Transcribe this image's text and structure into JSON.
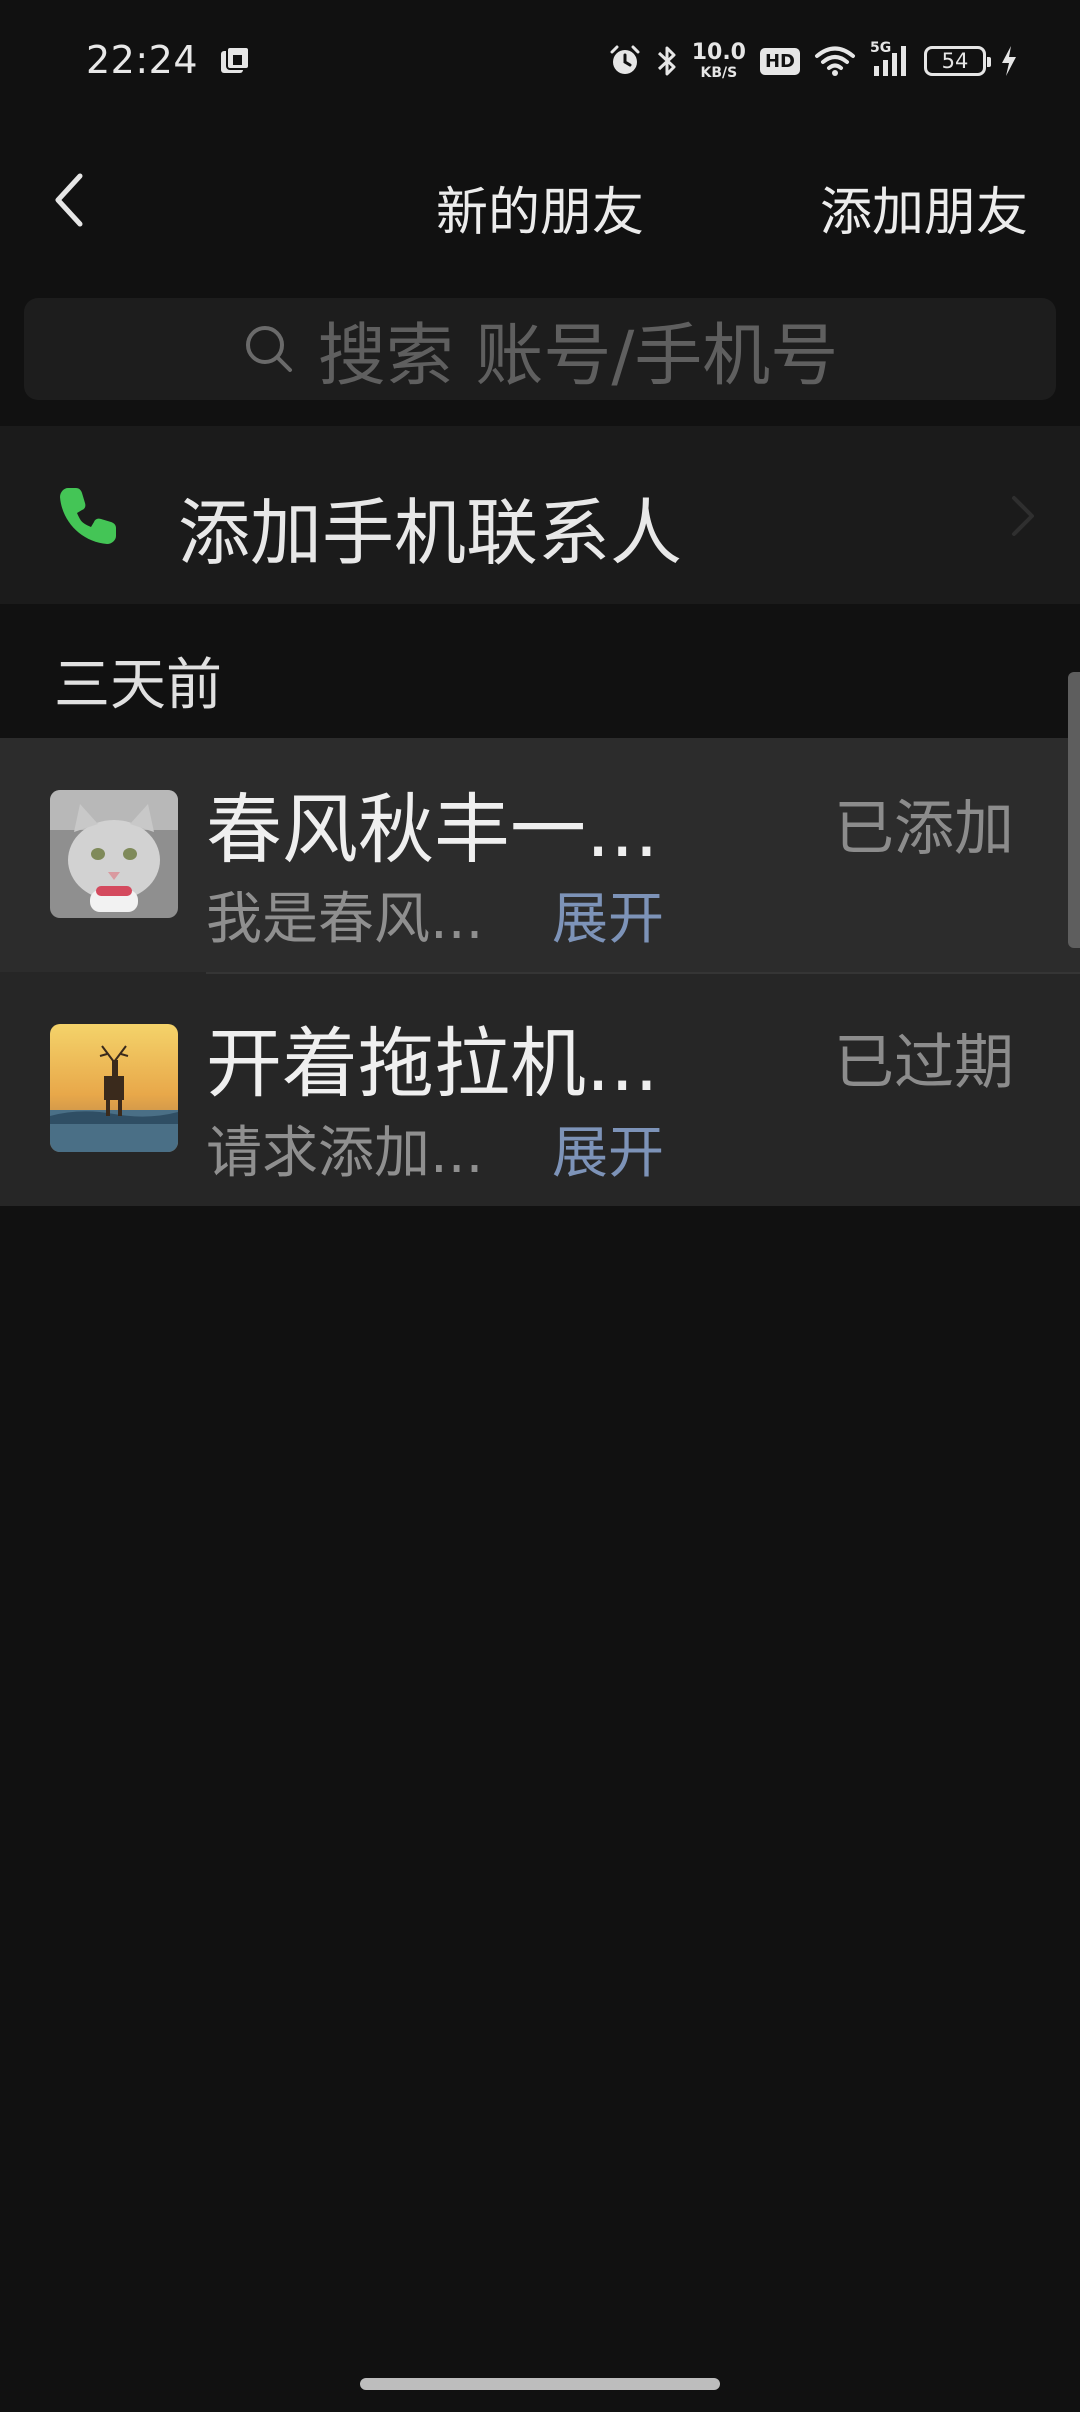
{
  "status_bar": {
    "time": "22:24",
    "network_speed_value": "10.0",
    "network_speed_unit": "KB/S",
    "hd_label": "HD",
    "signal_label": "5G",
    "battery_level": "54",
    "icons": [
      "app-notification-icon",
      "alarm-icon",
      "bluetooth-icon",
      "wifi-icon",
      "cell-signal-icon",
      "charging-icon"
    ]
  },
  "header": {
    "title": "新的朋友",
    "action_label": "添加朋友"
  },
  "search": {
    "placeholder": "搜索 账号/手机号"
  },
  "phone_contacts": {
    "label": "添加手机联系人",
    "icon_color": "#44c556"
  },
  "section": {
    "label": "三天前"
  },
  "requests": [
    {
      "name": "春风秋丰一...",
      "note": "我是春风...",
      "expand_label": "展开",
      "status": "已添加"
    },
    {
      "name": "开着拖拉机...",
      "note": "请求添加...",
      "expand_label": "展开",
      "status": "已过期"
    }
  ],
  "colors": {
    "background": "#111111",
    "row_background": "#2c2c2c",
    "link": "#7d93b8"
  }
}
